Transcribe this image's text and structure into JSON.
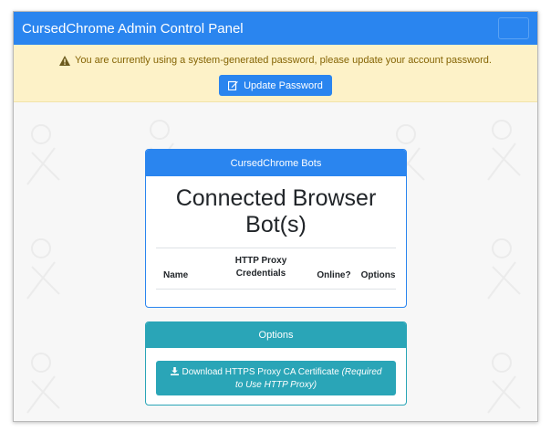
{
  "navbar": {
    "brand": "CursedChrome Admin Control Panel"
  },
  "alert": {
    "message": "You are currently using a system-generated password, please update your account password.",
    "button_label": "Update Password"
  },
  "bots_card": {
    "header": "CursedChrome Bots",
    "title_line1": "Connected Browser",
    "title_line2": "Bot(s)",
    "columns": {
      "name": "Name",
      "credentials_line1": "HTTP Proxy",
      "credentials_line2": "Credentials",
      "online": "Online?",
      "options": "Options"
    }
  },
  "options_card": {
    "header": "Options",
    "download_label": "Download HTTPS Proxy CA Certificate",
    "download_note": "(Required to Use HTTP Proxy)"
  },
  "colors": {
    "primary": "#2a85ef",
    "info": "#2aa5b7",
    "warning_bg": "#fdf2c8",
    "warning_text": "#856404"
  }
}
